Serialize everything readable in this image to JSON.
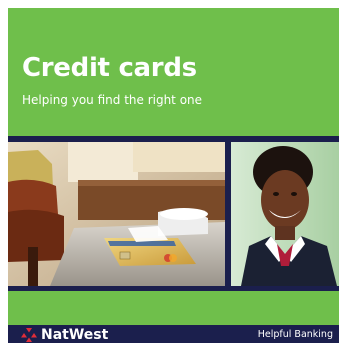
{
  "cover": {
    "title": "Credit cards",
    "subtitle": "Helping you find the right one"
  },
  "footer": {
    "brand_name": "NatWest",
    "tagline": "Helpful Banking"
  },
  "colors": {
    "brand_green": "#6fbf4b",
    "brand_navy": "#1b1f4d",
    "logo_red": "#e12d39"
  },
  "icons": [
    "natwest-logo-icon"
  ]
}
